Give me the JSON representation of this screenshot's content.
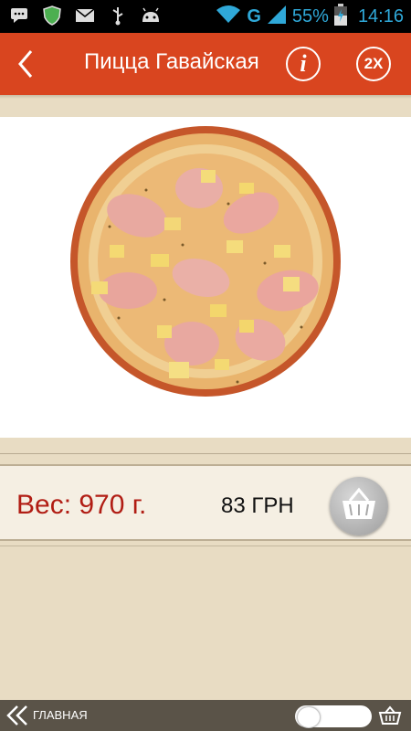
{
  "status_bar": {
    "network": "G",
    "battery": "55%",
    "time": "14:16",
    "icons": [
      "chat-icon",
      "shield-icon",
      "mail-icon",
      "usb-icon",
      "android-icon",
      "wifi-icon",
      "signal-icon",
      "battery-icon"
    ]
  },
  "header": {
    "title": "Пицца Гавайская",
    "info_label": "i",
    "zoom_label": "2X",
    "accent": "#d9451f"
  },
  "product": {
    "image": "pizza-image",
    "weight": "Вес: 970 г.",
    "price": "83 ГРН",
    "weight_color": "#b11d14"
  },
  "bottom_bar": {
    "home_label": "ГЛАВНАЯ"
  }
}
